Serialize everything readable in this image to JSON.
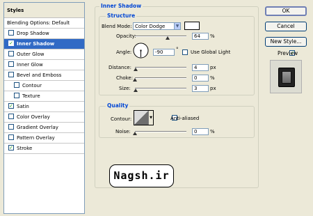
{
  "styles_panel": {
    "header": "Styles",
    "items": [
      {
        "label": "Blending Options: Default",
        "checkbox": false,
        "checked": false,
        "selected": false,
        "indent": false
      },
      {
        "label": "Drop Shadow",
        "checkbox": true,
        "checked": false,
        "selected": false,
        "indent": false
      },
      {
        "label": "Inner Shadow",
        "checkbox": true,
        "checked": true,
        "selected": true,
        "indent": false
      },
      {
        "label": "Outer Glow",
        "checkbox": true,
        "checked": false,
        "selected": false,
        "indent": false
      },
      {
        "label": "Inner Glow",
        "checkbox": true,
        "checked": false,
        "selected": false,
        "indent": false
      },
      {
        "label": "Bevel and Emboss",
        "checkbox": true,
        "checked": false,
        "selected": false,
        "indent": false
      },
      {
        "label": "Contour",
        "checkbox": true,
        "checked": false,
        "selected": false,
        "indent": true
      },
      {
        "label": "Texture",
        "checkbox": true,
        "checked": false,
        "selected": false,
        "indent": true
      },
      {
        "label": "Satin",
        "checkbox": true,
        "checked": true,
        "selected": false,
        "indent": false
      },
      {
        "label": "Color Overlay",
        "checkbox": true,
        "checked": false,
        "selected": false,
        "indent": false
      },
      {
        "label": "Gradient Overlay",
        "checkbox": true,
        "checked": false,
        "selected": false,
        "indent": false
      },
      {
        "label": "Pattern Overlay",
        "checkbox": true,
        "checked": false,
        "selected": false,
        "indent": false
      },
      {
        "label": "Stroke",
        "checkbox": true,
        "checked": true,
        "selected": false,
        "indent": false
      }
    ]
  },
  "inner_shadow": {
    "title": "Inner Shadow",
    "structure_title": "Structure",
    "blend_mode_label": "Blend Mode:",
    "blend_mode_value": "Color Dodge",
    "swatch_color": "#ffffff",
    "opacity_label": "Opacity:",
    "opacity_value": "64",
    "opacity_unit": "%",
    "opacity_level": 0.64,
    "angle_label": "Angle:",
    "angle_value": "-90",
    "angle_unit": "°",
    "use_global_light_label": "Use Global Light",
    "distance_label": "Distance:",
    "distance_value": "4",
    "distance_unit": "px",
    "distance_level": 0.02,
    "choke_label": "Choke:",
    "choke_value": "0",
    "choke_unit": "%",
    "choke_level": 0,
    "size_label": "Size:",
    "size_value": "3",
    "size_unit": "px",
    "size_level": 0.02,
    "quality_title": "Quality",
    "contour_label": "Contour:",
    "anti_aliased_label": "Anti-aliased",
    "noise_label": "Noise:",
    "noise_value": "0",
    "noise_unit": "%",
    "noise_level": 0
  },
  "watermark": "Nagsh.ir",
  "buttons": {
    "ok": "OK",
    "cancel": "Cancel",
    "new_style": "New Style...",
    "preview": "Preview"
  }
}
